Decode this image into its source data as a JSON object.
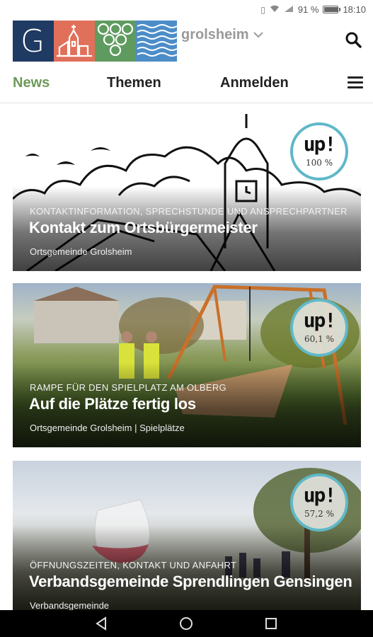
{
  "status_bar": {
    "battery": "91 %",
    "battery_level": 0.91,
    "time": "18:10"
  },
  "header": {
    "town": "grolsheim",
    "logo_letter": "G",
    "icons": {
      "search": "search-icon",
      "dropdown": "chevron-down-icon"
    }
  },
  "nav": {
    "tabs": [
      {
        "label": "News",
        "active": true
      },
      {
        "label": "Themen",
        "active": false
      },
      {
        "label": "Anmelden",
        "active": false
      }
    ],
    "menu_icon": "hamburger-menu-icon"
  },
  "colors": {
    "accent": "#6f9a58",
    "badge_ring": "#5fb8c8"
  },
  "cards": [
    {
      "kicker": "KONTAKTINFORMATION, SPRECHSTUNDE UND ANSPRECHPARTNER",
      "title": "Kontakt zum Ortsbürgermeister",
      "source": "Ortsgemeinde Grolsheim",
      "badge": {
        "label": "up!",
        "value": "100 %"
      }
    },
    {
      "kicker": "RAMPE FÜR DEN SPIELPLATZ AM OLBERG",
      "title": "Auf die Plätze fertig los",
      "source": "Ortsgemeinde Grolsheim | Spielplätze",
      "badge": {
        "label": "up!",
        "value": "60,1 %"
      }
    },
    {
      "kicker": "ÖFFNUNGSZEITEN, KONTAKT UND ANFAHRT",
      "title": "Verbandsgemeinde Sprendlingen Gensingen",
      "source": "Verbandsgemeinde",
      "badge": {
        "label": "up!",
        "value": "57,2 %"
      }
    }
  ],
  "system_nav": {
    "back": "back-icon",
    "home": "home-icon",
    "recents": "recents-icon"
  }
}
